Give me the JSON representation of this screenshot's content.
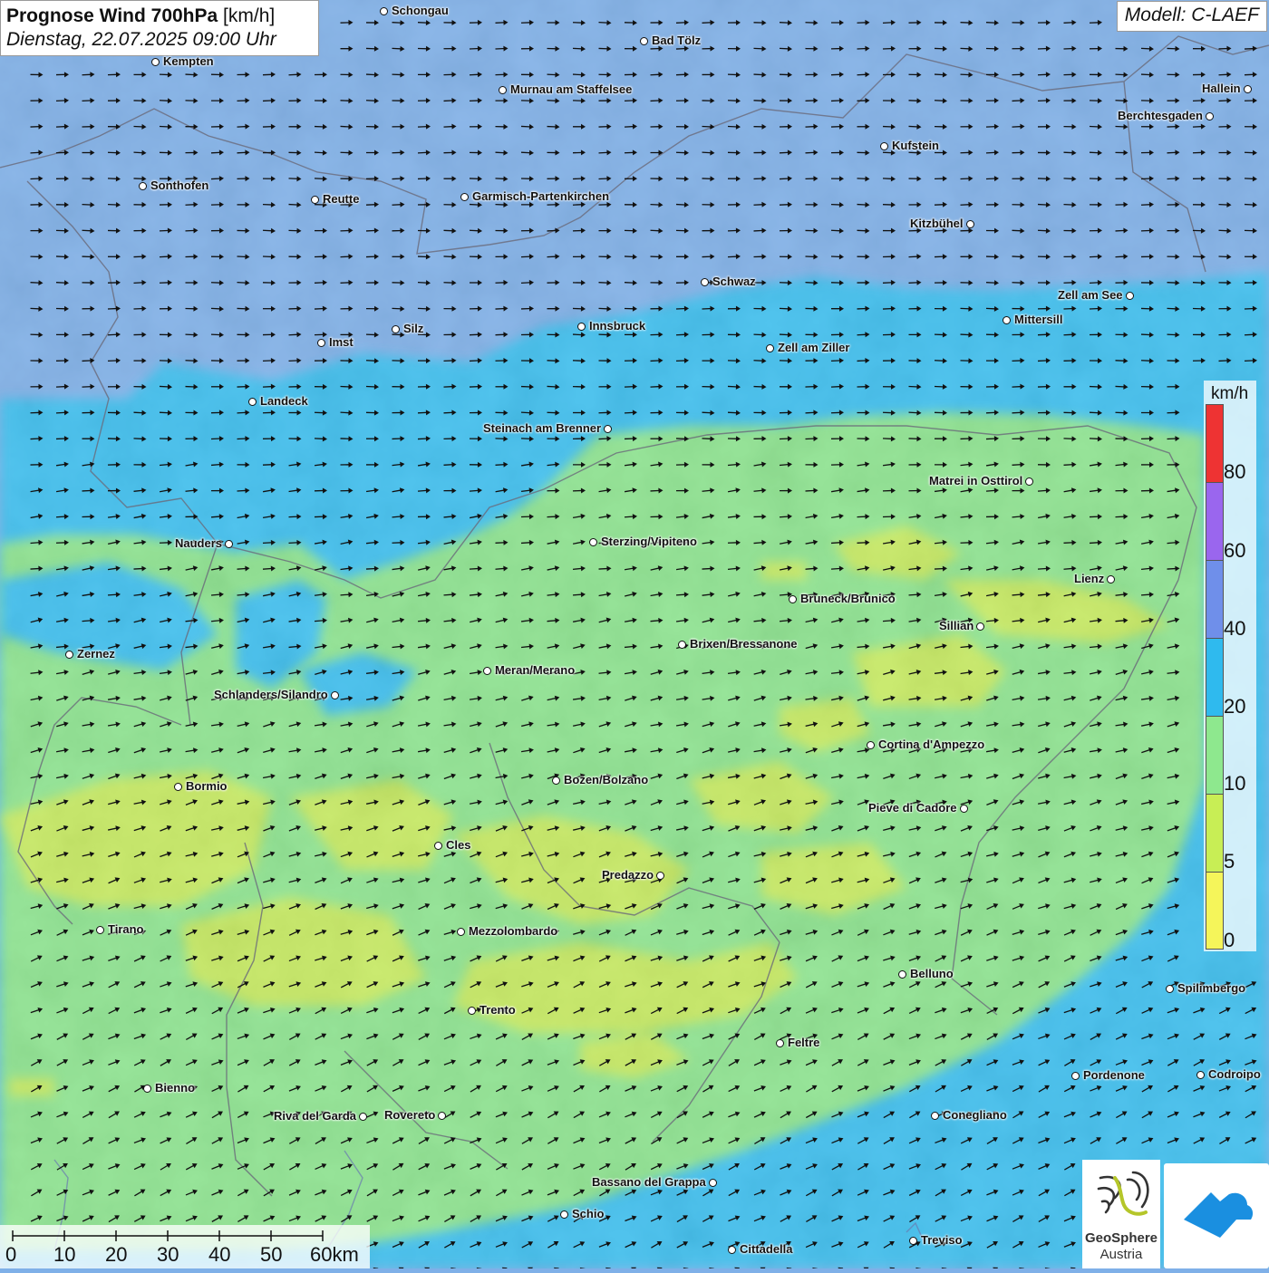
{
  "title": {
    "main": "Prognose Wind 700hPa",
    "unit": "[km/h]",
    "date": "Dienstag, 22.07.2025 09:00 Uhr"
  },
  "model": "Modell: C-LAEF",
  "legend": {
    "unit": "km/h",
    "labels": [
      "80",
      "60",
      "40",
      "20",
      "10",
      "5",
      "0"
    ],
    "colors": [
      "#ee3333",
      "#9a66ee",
      "#6f8fea",
      "#2fbaee",
      "#8ee88e",
      "#c8ee55",
      "#f5f55a"
    ]
  },
  "scale": {
    "labels": [
      "0",
      "10",
      "20",
      "30",
      "40",
      "50",
      "60km"
    ]
  },
  "logos": {
    "geosphere_line1": "GeoSphere",
    "geosphere_line2": "Austria"
  },
  "cities": [
    {
      "name": "Schongau"
    },
    {
      "name": "Bad Tölz"
    },
    {
      "name": "Kempten"
    },
    {
      "name": "Murnau am Staffelsee"
    },
    {
      "name": "Hallein"
    },
    {
      "name": "Berchtesgaden"
    },
    {
      "name": "Kufstein"
    },
    {
      "name": "Sonthofen"
    },
    {
      "name": "Reutte"
    },
    {
      "name": "Garmisch-Partenkirchen"
    },
    {
      "name": "Kitzbühel"
    },
    {
      "name": "Schwaz"
    },
    {
      "name": "Zell am See"
    },
    {
      "name": "Mittersill"
    },
    {
      "name": "Innsbruck"
    },
    {
      "name": "Silz"
    },
    {
      "name": "Imst"
    },
    {
      "name": "Zell am Ziller"
    },
    {
      "name": "Landeck"
    },
    {
      "name": "Steinach am Brenner"
    },
    {
      "name": "Matrei in Osttirol"
    },
    {
      "name": "Nauders"
    },
    {
      "name": "Sterzing/Vipiteno"
    },
    {
      "name": "Lienz"
    },
    {
      "name": "Bruneck/Brunico"
    },
    {
      "name": "Sillian"
    },
    {
      "name": "Zernez"
    },
    {
      "name": "Brixen/Bressanone"
    },
    {
      "name": "Meran/Merano"
    },
    {
      "name": "Schlanders/Silandro"
    },
    {
      "name": "Cortina d'Ampezzo"
    },
    {
      "name": "Bozen/Bolzano"
    },
    {
      "name": "Bormio"
    },
    {
      "name": "Pieve di Cadore"
    },
    {
      "name": "Cles"
    },
    {
      "name": "Predazzo"
    },
    {
      "name": "Tirano"
    },
    {
      "name": "Mezzolombardo"
    },
    {
      "name": "Belluno"
    },
    {
      "name": "Spilimbergo"
    },
    {
      "name": "Trento"
    },
    {
      "name": "Feltre"
    },
    {
      "name": "Pordenone"
    },
    {
      "name": "Codroipo"
    },
    {
      "name": "Bienno"
    },
    {
      "name": "Riva del Garda"
    },
    {
      "name": "Rovereto"
    },
    {
      "name": "Conegliano"
    },
    {
      "name": "Bassano del Grappa"
    },
    {
      "name": "Schio"
    },
    {
      "name": "Treviso"
    },
    {
      "name": "Cittadella"
    }
  ]
}
